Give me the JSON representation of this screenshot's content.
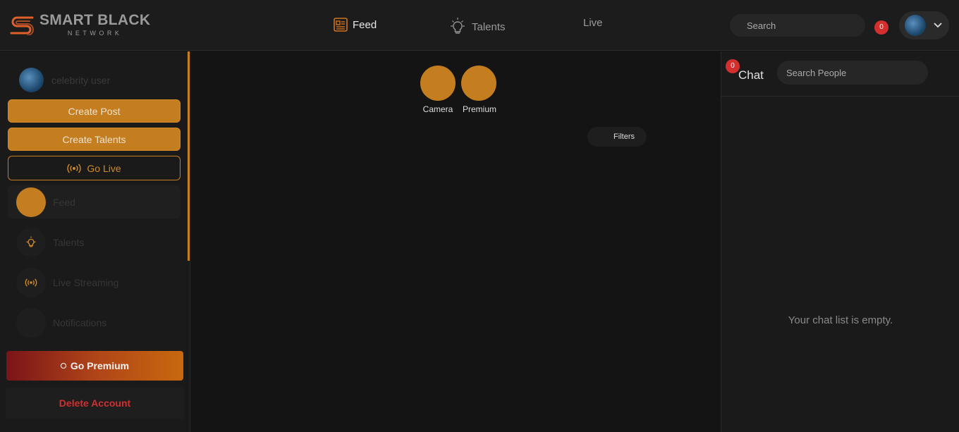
{
  "header": {
    "logo_title": "SMART BLACK",
    "logo_subtitle": "NETWORK",
    "nav": [
      {
        "label": "Feed",
        "icon": "feed-icon",
        "active": true
      },
      {
        "label": "Talents",
        "icon": "bulb-icon",
        "active": false
      },
      {
        "label": "Live",
        "icon": "",
        "active": false
      }
    ],
    "search_placeholder": "Search",
    "notification_count": "0"
  },
  "sidebar": {
    "user_name": "celebrity user",
    "create_post": "Create Post",
    "create_talents": "Create Talents",
    "go_live": "Go Live",
    "items": [
      {
        "label": "Feed",
        "icon": "feed-icon",
        "active": true
      },
      {
        "label": "Talents",
        "icon": "bulb-icon",
        "active": false
      },
      {
        "label": "Live Streaming",
        "icon": "broadcast-icon",
        "active": false
      },
      {
        "label": "Notifications",
        "icon": "bell-icon",
        "active": false
      }
    ],
    "go_premium": "Go Premium",
    "delete_account": "Delete Account"
  },
  "main": {
    "quick_actions": [
      {
        "label": "Camera"
      },
      {
        "label": "Premium"
      }
    ],
    "filters": "Filters"
  },
  "chat": {
    "title": "Chat",
    "unread_count": "0",
    "search_placeholder": "Search People",
    "empty_text": "Your chat list is empty."
  },
  "colors": {
    "accent": "#c47e20",
    "badge": "#d32f2f",
    "danger": "#d03030",
    "background": "#141414",
    "panel": "#1a1a1a"
  }
}
